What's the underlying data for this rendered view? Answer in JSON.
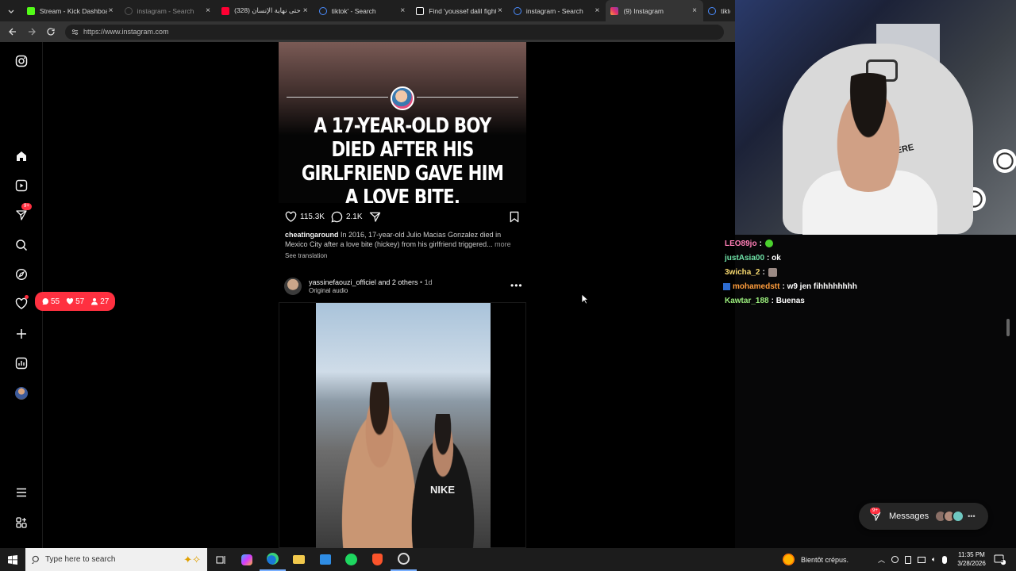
{
  "browser": {
    "tabs": [
      {
        "title": "Stream - Kick Dashboard",
        "icon": "kick-icon",
        "color": "#53fc18",
        "state": "normal"
      },
      {
        "title": "instagram - Search",
        "icon": "search-icon",
        "color": "#555555",
        "state": "dim"
      },
      {
        "title": "حتى نهاية الإنسان (328) ٔ",
        "icon": "youtube-icon",
        "color": "#ff0033",
        "state": "normal"
      },
      {
        "title": "tiktok' - Search",
        "icon": "search-icon",
        "color": "#4a8cff",
        "state": "normal"
      },
      {
        "title": "Find 'youssef dalil fight'",
        "icon": "tiktok-icon",
        "color": "#ffffff",
        "state": "normal"
      },
      {
        "title": "instagram - Search",
        "icon": "search-icon",
        "color": "#4a8cff",
        "state": "normal"
      },
      {
        "title": "(9) Instagram",
        "icon": "instagram-icon",
        "color": "#e1306c",
        "state": "active"
      },
      {
        "title": "tikto",
        "icon": "search-icon",
        "color": "#4a8cff",
        "state": "normal"
      }
    ],
    "url": "https://www.instagram.com"
  },
  "instagram": {
    "nav_badge": "9+",
    "activity_popup": {
      "comments": "55",
      "likes": "57",
      "follows": "27"
    },
    "post1": {
      "headline": "A 17-YEAR-OLD BOY DIED AFTER HIS GIRLFRIEND GAVE HIM A LOVE BITE.",
      "likes": "115.3K",
      "comments": "2.1K",
      "username": "cheatingaround",
      "caption": "In 2016, 17-year-old Julio Macias Gonzalez died in Mexico City after a love bite (hickey) from his girlfriend triggered...",
      "more": "more",
      "see_translation": "See translation"
    },
    "post2": {
      "username": "yassinefaouzi_officiel",
      "others": "and 2 others",
      "time": "1d",
      "audio": "Original audio",
      "shirt_text": "NIKE"
    },
    "messages": {
      "label": "Messages",
      "badge": "9+"
    }
  },
  "webcam": {
    "chair_text": "KERE"
  },
  "chat": {
    "messages": [
      {
        "user": "LEO89jo",
        "text": "",
        "color": "#ff7eb6",
        "emote": "green-blob-emote"
      },
      {
        "user": "justAsia00",
        "text": "ok",
        "color": "#6fe3a8",
        "emote": ""
      },
      {
        "user": "3wicha_2",
        "text": "",
        "color": "#f5d76e",
        "emote": "face-emote"
      },
      {
        "user": "mohamedstt",
        "text": "w9 jen fihhhhhhhh",
        "color": "#ff9d3c",
        "emote": "badge-icon"
      },
      {
        "user": "Kawtar_188",
        "text": "Buenas",
        "color": "#9bee7d",
        "emote": ""
      }
    ]
  },
  "taskbar": {
    "search_placeholder": "Type here to search",
    "weather": "Bientôt crépus.",
    "time": "11:35 PM",
    "date": "3/28/2026",
    "notifications": "2"
  }
}
